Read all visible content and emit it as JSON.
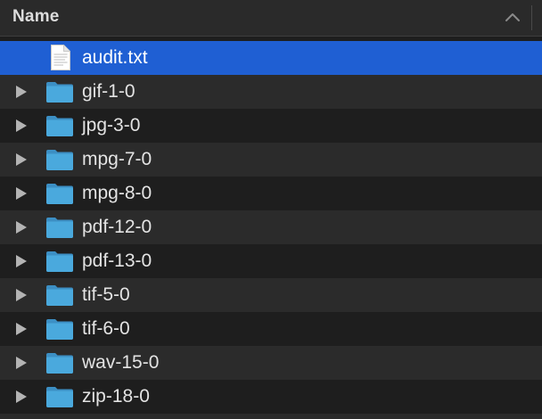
{
  "header": {
    "name_label": "Name",
    "sort_icon": "chevron-up-icon"
  },
  "colors": {
    "background": "#1e1e1e",
    "stripe": "#2b2b2b",
    "selection": "#1f5fd3",
    "folder": "#4aa9dd",
    "text": "#e3e3e3"
  },
  "items": [
    {
      "label": "audit.txt",
      "kind": "file",
      "icon": "text-file-icon",
      "selected": true
    },
    {
      "label": "gif-1-0",
      "kind": "folder",
      "icon": "folder-icon",
      "selected": false
    },
    {
      "label": "jpg-3-0",
      "kind": "folder",
      "icon": "folder-icon",
      "selected": false
    },
    {
      "label": "mpg-7-0",
      "kind": "folder",
      "icon": "folder-icon",
      "selected": false
    },
    {
      "label": "mpg-8-0",
      "kind": "folder",
      "icon": "folder-icon",
      "selected": false
    },
    {
      "label": "pdf-12-0",
      "kind": "folder",
      "icon": "folder-icon",
      "selected": false
    },
    {
      "label": "pdf-13-0",
      "kind": "folder",
      "icon": "folder-icon",
      "selected": false
    },
    {
      "label": "tif-5-0",
      "kind": "folder",
      "icon": "folder-icon",
      "selected": false
    },
    {
      "label": "tif-6-0",
      "kind": "folder",
      "icon": "folder-icon",
      "selected": false
    },
    {
      "label": "wav-15-0",
      "kind": "folder",
      "icon": "folder-icon",
      "selected": false
    },
    {
      "label": "zip-18-0",
      "kind": "folder",
      "icon": "folder-icon",
      "selected": false
    }
  ]
}
